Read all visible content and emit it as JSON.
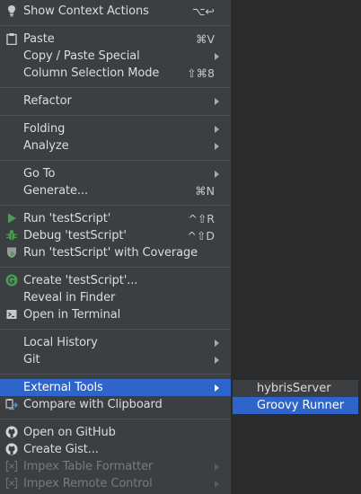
{
  "menu": {
    "show_context_actions": {
      "label": "Show Context Actions",
      "shortcut": "⌥↩"
    },
    "paste": {
      "label": "Paste",
      "shortcut": "⌘V"
    },
    "copy_paste_special": {
      "label": "Copy / Paste Special"
    },
    "column_selection_mode": {
      "label": "Column Selection Mode",
      "shortcut": "⇧⌘8"
    },
    "refactor": {
      "label": "Refactor"
    },
    "folding": {
      "label": "Folding"
    },
    "analyze": {
      "label": "Analyze"
    },
    "go_to": {
      "label": "Go To"
    },
    "generate": {
      "label": "Generate...",
      "shortcut": "⌘N"
    },
    "run": {
      "label": "Run 'testScript'",
      "shortcut": "^⇧R"
    },
    "debug": {
      "label": "Debug 'testScript'",
      "shortcut": "^⇧D"
    },
    "run_coverage": {
      "label": "Run 'testScript' with Coverage"
    },
    "create": {
      "label": "Create 'testScript'..."
    },
    "reveal_in_finder": {
      "label": "Reveal in Finder"
    },
    "open_in_terminal": {
      "label": "Open in Terminal"
    },
    "local_history": {
      "label": "Local History"
    },
    "git": {
      "label": "Git"
    },
    "external_tools": {
      "label": "External Tools"
    },
    "compare_clipboard": {
      "label": "Compare with Clipboard"
    },
    "open_on_github": {
      "label": "Open on GitHub"
    },
    "create_gist": {
      "label": "Create Gist..."
    },
    "impex_table_formatter": {
      "label": "Impex Table Formatter"
    },
    "impex_remote_control": {
      "label": "Impex Remote Control"
    }
  },
  "submenu": {
    "hybris_server": {
      "label": "hybrisServer"
    },
    "groovy_runner": {
      "label": "Groovy Runner"
    }
  },
  "colors": {
    "menu_bg": "#3c3f41",
    "selection": "#2f65ca",
    "run_green": "#499c54",
    "text": "#dcdcdc",
    "disabled_text": "#7a7a7a"
  }
}
